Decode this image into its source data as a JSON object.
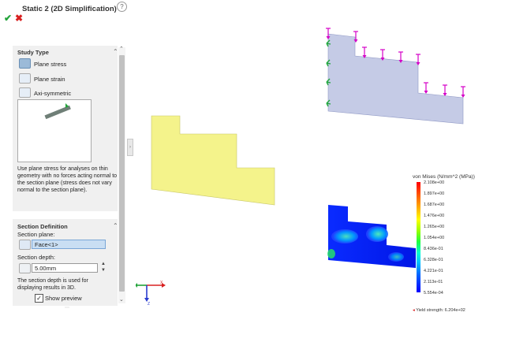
{
  "panel": {
    "title": "Static 2 (2D Simplification)",
    "help_icon": "?",
    "ok_icon": "✔",
    "cancel_icon": "✖"
  },
  "study_type": {
    "title": "Study Type",
    "options": [
      {
        "label": "Plane stress",
        "selected": true
      },
      {
        "label": "Plane strain",
        "selected": false
      },
      {
        "label": "Axi-symmetric",
        "selected": false
      }
    ],
    "help_text": "Use plane stress for analyses on thin geometry with no forces acting normal to the section plane (stress does not vary normal to the section plane)."
  },
  "section_definition": {
    "title": "Section Definition",
    "plane_label": "Section plane:",
    "plane_value": "Face<1>",
    "depth_label": "Section depth:",
    "depth_value": "5.00mm",
    "depth_note": "The section depth is used for displaying results in 3D.",
    "show_preview_label": "Show preview",
    "show_preview_checked": true
  },
  "legend": {
    "title": "von Mises (N/mm^2 (MPa))",
    "ticks": [
      "2.108e+00",
      "1.897e+00",
      "1.687e+00",
      "1.476e+00",
      "1.265e+00",
      "1.054e+00",
      "8.436e-01",
      "6.328e-01",
      "4.221e-01",
      "2.113e-01",
      "5.554e-04"
    ],
    "yield_label": "Yield strength: 6.204e+02"
  },
  "triad": {
    "x": "X",
    "y": "Y",
    "z": "Z"
  },
  "colors": {
    "accent_ok": "#22a33a",
    "accent_cancel": "#d82020",
    "yellow_part": "#f4f38b",
    "blue_part": "#c5cbe6",
    "load_arrow": "#d400c8",
    "fixture": "#1fa83a"
  }
}
